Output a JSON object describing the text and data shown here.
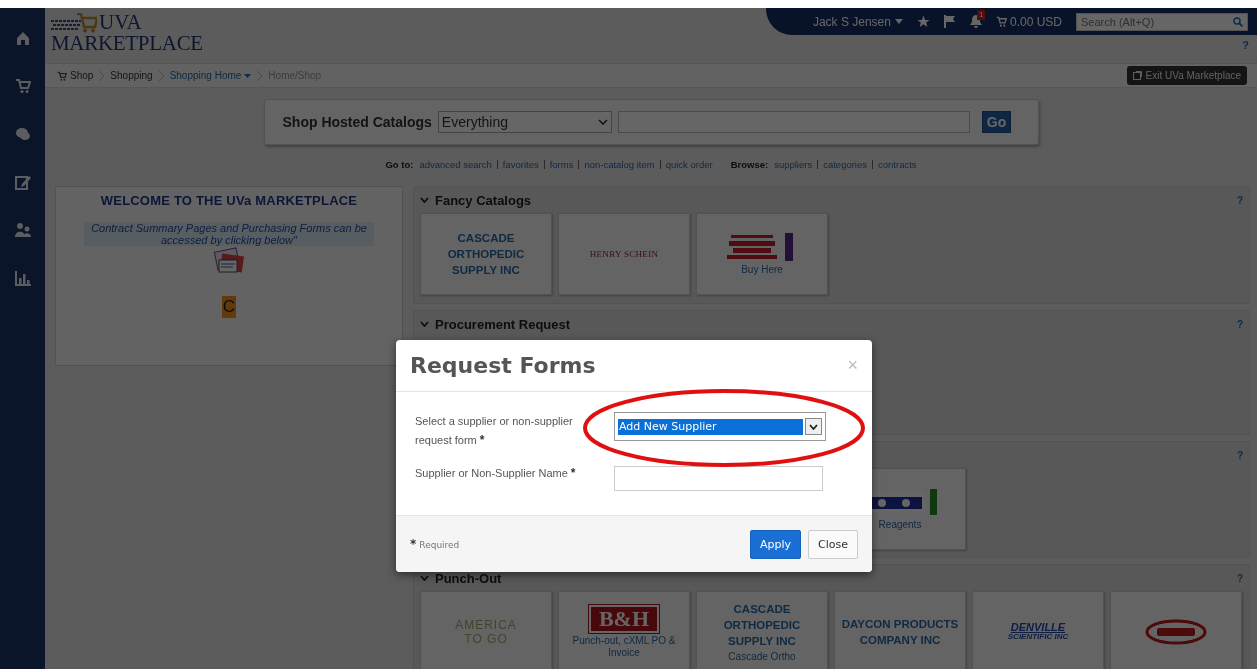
{
  "top_bar": {
    "user": "Jack S Jensen",
    "notification_count": "1",
    "cart_total": "0.00 USD",
    "search": {
      "placeholder": "Search (Alt+Q)"
    }
  },
  "logo": {
    "line_1": "UVA",
    "line_2": "MARKETPLACE"
  },
  "help": "?",
  "breadcrumb": [
    {
      "label": "Shop",
      "kind": "root"
    },
    {
      "label": "Shopping",
      "kind": "link"
    },
    {
      "label": "Shopping Home",
      "kind": "menu"
    },
    {
      "label": "Home/Shop",
      "kind": "current"
    }
  ],
  "exit_button": "Exit UVa Marketplace",
  "catalog_search": {
    "label": "Shop Hosted Catalogs",
    "scope": "Everything",
    "button": "Go"
  },
  "quick_links": {
    "goto_label": "Go to:",
    "goto": [
      "advanced search",
      "favorites",
      "forms",
      "non-catalog item",
      "quick order"
    ],
    "browse_label": "Browse:",
    "browse": [
      "suppliers",
      "categories",
      "contracts"
    ]
  },
  "welcome": {
    "title": "WELCOME TO THE UVa MARKETPLACE",
    "text": "Contract Summary Pages and Purchasing Forms can be accessed by clicking below\"",
    "tile_letter": "C"
  },
  "sections": [
    {
      "title": "Fancy Catalogs",
      "help": "?",
      "tiles": [
        {
          "kind": "wordmark",
          "lines": [
            "CASCADE",
            "ORTHOPEDIC",
            "SUPPLY INC"
          ]
        },
        {
          "kind": "small-wordmark",
          "lines": [
            "HENRY SCHEIN"
          ]
        },
        {
          "kind": "supply-logo",
          "caption": "Buy Here"
        }
      ]
    },
    {
      "title": "Procurement Request",
      "help": "?"
    },
    {
      "help": "?",
      "tiles": [
        {
          "kind": "qb-logo",
          "caption": "Reagents"
        }
      ]
    },
    {
      "title": "Punch-Out",
      "help": "?",
      "tiles": [
        {
          "kind": "spaced-wordmark",
          "lines": [
            "AMERICA",
            "TO GO"
          ]
        },
        {
          "kind": "bh-logo",
          "lines": [
            "B&H"
          ],
          "caption": "Punch-out, cXML PO & Invoice"
        },
        {
          "kind": "wordmark",
          "lines": [
            "CASCADE",
            "ORTHOPEDIC",
            "SUPPLY INC"
          ],
          "caption": "Cascade Ortho"
        },
        {
          "kind": "wordmark",
          "lines": [
            "DAYCON PRODUCTS",
            "COMPANY INC"
          ]
        },
        {
          "kind": "italic-wordmark",
          "lines": [
            "DENVILLE",
            "SCIENTIFIC INC"
          ]
        },
        {
          "kind": "oval-logo"
        }
      ]
    }
  ],
  "modal": {
    "title": "Request Forms",
    "close": "×",
    "fields": [
      {
        "kind": "select",
        "label": "Select a supplier or non-supplier request form",
        "marker": "*",
        "value": "Add New Supplier"
      },
      {
        "kind": "text",
        "label": "Supplier or Non-Supplier Name",
        "marker": "*"
      }
    ],
    "required_note": {
      "marker": "*",
      "text": "Required"
    },
    "buttons": [
      {
        "label": "Apply",
        "kind": "primary"
      },
      {
        "label": "Close",
        "kind": "default"
      }
    ]
  }
}
